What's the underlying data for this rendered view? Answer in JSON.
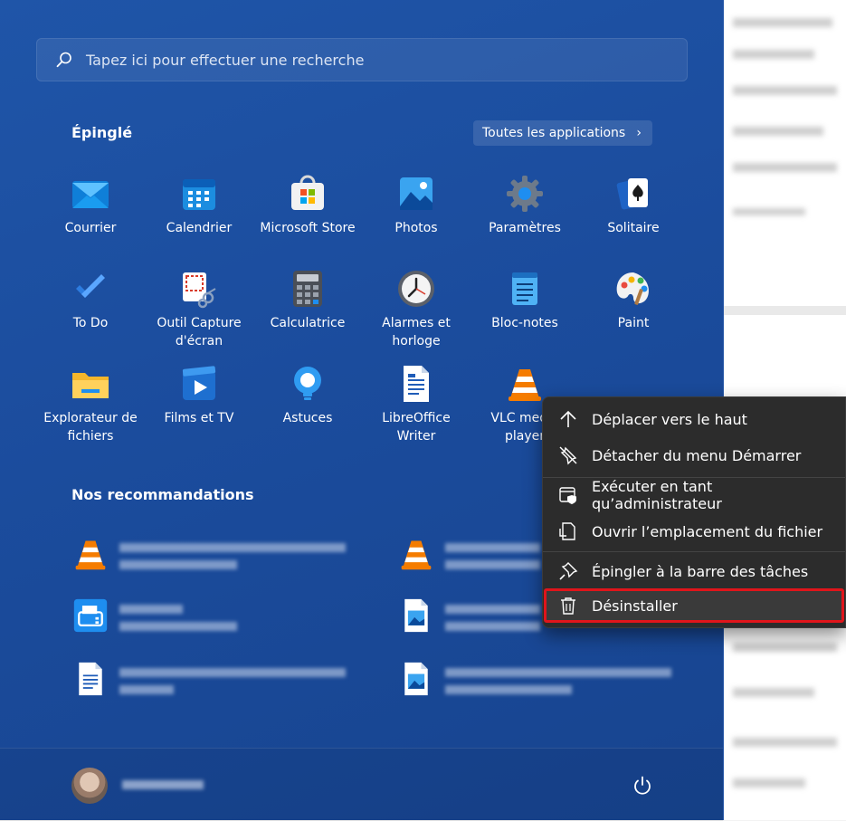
{
  "search": {
    "placeholder": "Tapez ici pour effectuer une recherche"
  },
  "pinned": {
    "title": "Épinglé",
    "all_apps_label": "Toutes les applications",
    "apps": [
      {
        "label": "Courrier",
        "icon": "mail-icon"
      },
      {
        "label": "Calendrier",
        "icon": "calendar-icon"
      },
      {
        "label": "Microsoft Store",
        "icon": "store-icon"
      },
      {
        "label": "Photos",
        "icon": "photos-icon"
      },
      {
        "label": "Paramètres",
        "icon": "gear-icon"
      },
      {
        "label": "Solitaire",
        "icon": "cards-icon"
      },
      {
        "label": "To Do",
        "icon": "checkmark-icon"
      },
      {
        "label": "Outil Capture d'écran",
        "icon": "snipping-icon"
      },
      {
        "label": "Calculatrice",
        "icon": "calculator-icon"
      },
      {
        "label": "Alarmes et horloge",
        "icon": "clock-icon"
      },
      {
        "label": "Bloc-notes",
        "icon": "notepad-icon"
      },
      {
        "label": "Paint",
        "icon": "palette-icon"
      },
      {
        "label": "Explorateur de fichiers",
        "icon": "folder-icon"
      },
      {
        "label": "Films et TV",
        "icon": "play-icon"
      },
      {
        "label": "Astuces",
        "icon": "lightbulb-icon"
      },
      {
        "label": "LibreOffice Writer",
        "icon": "writer-icon"
      },
      {
        "label": "VLC media player",
        "icon": "vlc-icon"
      }
    ]
  },
  "recommended": {
    "title": "Nos recommandations"
  },
  "context_menu": {
    "items": [
      {
        "label": "Déplacer vers le haut",
        "icon": "arrow-up-icon"
      },
      {
        "label": "Détacher du menu Démarrer",
        "icon": "unpin-icon"
      },
      {
        "label": "Exécuter en tant qu’administrateur",
        "icon": "shield-window-icon"
      },
      {
        "label": "Ouvrir l’emplacement du fichier",
        "icon": "file-location-icon"
      },
      {
        "label": "Épingler à la barre des tâches",
        "icon": "pin-icon"
      },
      {
        "label": "Désinstaller",
        "icon": "trash-icon"
      }
    ]
  },
  "colors": {
    "accent": "#1b4c9d",
    "highlight_outline": "#e0151b",
    "menu_bg": "#2c2c2c"
  }
}
